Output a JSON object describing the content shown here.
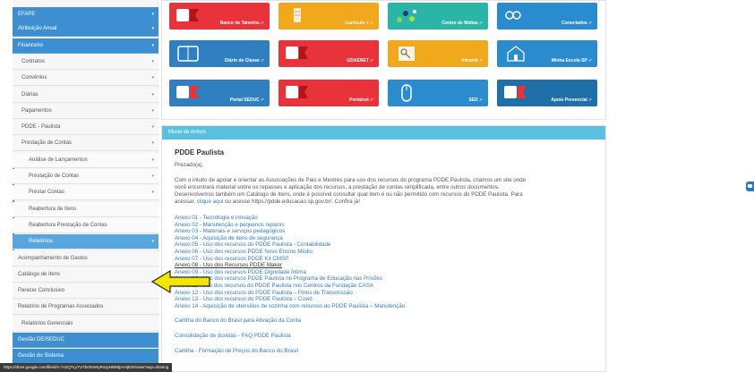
{
  "sidebar": {
    "items": [
      {
        "label": "EFAPE"
      },
      {
        "label": "Atribuição Anual"
      },
      {
        "label": "Financeiro"
      },
      {
        "label": "Contratos"
      },
      {
        "label": "Convênios"
      },
      {
        "label": "Diárias"
      },
      {
        "label": "Pagamentos"
      },
      {
        "label": "PDDE - Paulista"
      },
      {
        "label": "Prestação de Contas"
      },
      {
        "label": "Análise de Lançamentos"
      },
      {
        "label": "Prestação de Contas"
      },
      {
        "label": "Prestar Contas"
      },
      {
        "label": "Reabertura de Itens"
      },
      {
        "label": "Reabertura Prestação de Contas"
      },
      {
        "label": "Relatórios"
      },
      {
        "label": "Acompanhamento de Gastos"
      },
      {
        "label": "Catálogo de Itens"
      },
      {
        "label": "Parecer Conclusivo"
      },
      {
        "label": "Relatório de Programas Associados"
      },
      {
        "label": "Relatórios Gerenciais"
      },
      {
        "label": "Gestão DE/SEDUC"
      },
      {
        "label": "Gestão do Sistema"
      }
    ]
  },
  "tiles": [
    {
      "label": "Banco de Talentos",
      "color": "#e8333a"
    },
    {
      "label": "Currículo +",
      "color": "#f2a81d"
    },
    {
      "label": "Centro de Mídias",
      "color": "#2bb5a6"
    },
    {
      "label": "Conectados",
      "color": "#2b8bcf",
      "prefix": "Conectados"
    },
    {
      "label": "Diário de Classe",
      "color": "#2f7fc1"
    },
    {
      "label": "GDAENET",
      "color": "#e8333a"
    },
    {
      "label": "Intranet",
      "color": "#f2a81d"
    },
    {
      "label": "Minha Escola SP",
      "color": "#2b8bcf"
    },
    {
      "label": "Portal SEDUC",
      "color": "#2f7fc1"
    },
    {
      "label": "Portalnet",
      "color": "#e8333a"
    },
    {
      "label": "SED",
      "color": "#2b8bcf"
    },
    {
      "label": "Apoio Presencial",
      "color": "#1f6fa8"
    }
  ],
  "mural": {
    "header": "Mural de Avisos",
    "title": "PDDE Paulista",
    "greeting": "Prezado(a),",
    "paragraph_1": "Com o intuito de apoiar e orientar as Associações de Pais e Mestres para uso dos recursos do programa PDDE Paulista, criamos um site onde",
    "paragraph_2": "você encontrará material sobre os repasses e aplicação dos recursos, a prestação de contas simplificada, entre outros documentos.",
    "paragraph_3": "Desenvolvemos também um Catálogo de Itens, onde é possível consultar qual item é ou não permitido com recursos do PDDE Paulista. Para",
    "paragraph_4_a": "acessar, ",
    "paragraph_4_link": "clique aqui",
    "paragraph_4_b": " ou acesse https://pdde.educacao.sp.gov.br/. Confira já!",
    "annexes": [
      "Anexo 01 - Tecnologia e inovação",
      "Anexo 02 - Manutenção e pequenos reparos",
      "Anexo 03 - Materiais e serviços pedagógicos",
      "Anexo 04 - Aquisição de itens de segurança",
      "Anexo 05 - Uso dos recursos do PDDE Paulista - Contabilidade",
      "Anexo 06 - Uso dos recursos PDDE Novo Ensino Médio",
      "Anexo 07 - Uso dos recursos PDDE Kit CMSP",
      "Anexo 08 - Uso dos Recursos PDDE Maker",
      "Anexo 09 - Uso dos recursos PDDE Dignidade Íntima",
      "Anexo 10 - Uso dos recursos PDDE Paulista no Programa de Educação nas Prisões",
      "Anexo 11 - Uso dos recursos do PDDE Paulista nos Centros da Fundação CASA",
      "Anexo 12 - Uso dos recursos do PDDE Paulista – Pólos de Transmissão",
      "Anexo 13 - Uso dos recursos do PDDE Paulista – Covid",
      "Anexo 14 - Aquisição de utensílios de cozinha com recursos do PDDE Paulista – Manutenção"
    ],
    "link_cartilha": "Cartilha do Banco do Brasil para Ativação da Conta",
    "link_consolidacao": "Consolidação de dúvidas - FAQ PDDE Paulista",
    "link_partial": "Cartilha - Formação de Preços do Banco do Brasil"
  },
  "statusbar": {
    "url": "https://drive.google.com/file/d/1-7o2QTLyYV7bcRnWyRxcpHB9dpAHj53X/view?usp=sharing"
  },
  "colors": {
    "sidebar_blue": "#3d8fd1",
    "mural_header": "#5bc0de",
    "link": "#337ab7",
    "arrow": "#f2e600"
  }
}
